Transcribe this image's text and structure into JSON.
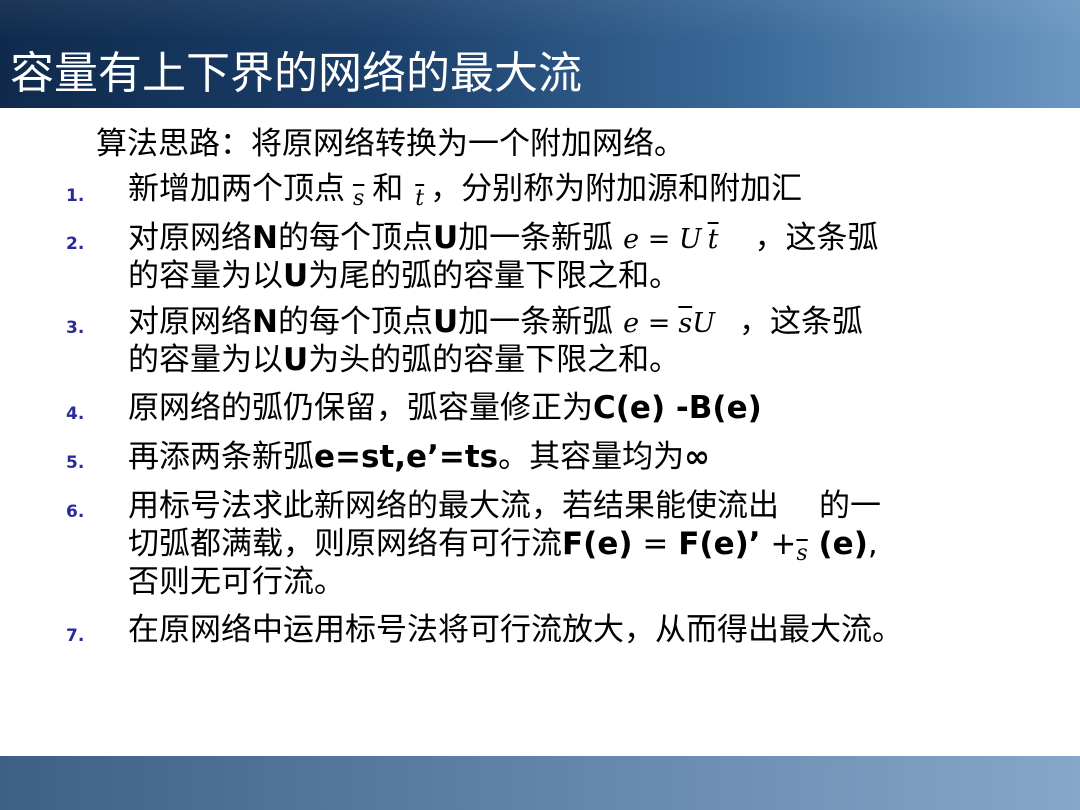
{
  "slide": {
    "title": "容量有上下界的网络的最大流",
    "intro": "算法思路：将原网络转换为一个附加网络。",
    "steps": [
      {
        "num": "1.",
        "a": "新增加两个顶点",
        "s_var": "s",
        "b": "和",
        "t_var": "t",
        "c": "，分别称为附加源和附加汇"
      },
      {
        "num": "2.",
        "a": "对原网络",
        "N": "N",
        "b": "的每个顶点",
        "U": "U",
        "c": "加一条新弧",
        "math": "e = U",
        "math_ov": "t",
        "d": "，这条弧",
        "line2_a": "的容量为以",
        "line2_U": "U",
        "line2_b": "为尾的弧的容量下限之和。"
      },
      {
        "num": "3.",
        "a": "对原网络",
        "N": "N",
        "b": "的每个顶点",
        "U": "U",
        "c": "加一条新弧",
        "math": "e =",
        "math_ov": "s",
        "math_tail": "U",
        "d": "，这条弧",
        "line2_a": "的容量为以",
        "line2_U": "U",
        "line2_b": "为头的弧的容量下限之和。"
      },
      {
        "num": "4.",
        "a": "原网络的弧仍保留，弧容量修正为",
        "bold": "C(e) -B(e)"
      },
      {
        "num": "5.",
        "a": "再添两条新弧",
        "bold": "e=st,e’=ts",
        "b": "。其容量均为",
        "inf": "∞"
      },
      {
        "num": "6.",
        "a": "用标号法求此新网络的最大流，若结果能使流出",
        "b": "的一",
        "line2_a": "切弧都满载，则原网络有可行流",
        "line2_bold1": "F(e)",
        "line2_eq": " = ",
        "line2_bold2": "F(e)’",
        "line2_plus": " +",
        "line2_s": "s",
        "line2_bold3": " (e)",
        "line2_end": ",",
        "line3": "否则无可行流。"
      },
      {
        "num": "7.",
        "a": "在原网络中运用标号法将可行流放大，从而得出最大流。"
      }
    ]
  }
}
